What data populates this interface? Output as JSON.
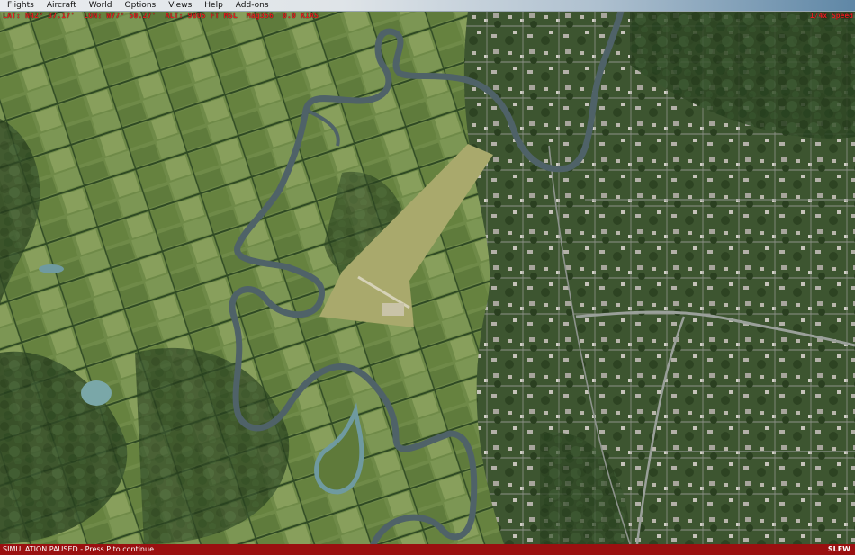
{
  "menu": {
    "items": [
      "Flights",
      "Aircraft",
      "World",
      "Options",
      "Views",
      "Help",
      "Add-ons"
    ]
  },
  "hud": {
    "readout": "LAT: N42° 37.17'  LON: W77° 50.27'  ALT: 9805 FT MSL  Mag356  0.0 KIAS",
    "right": "1/4x Speed"
  },
  "status": {
    "left": "SIMULATION PAUSED - Press P to continue.",
    "right": "SLEW"
  },
  "colors": {
    "hud_text": "#e22020",
    "status_bg": "#9a1010",
    "river": "#4f6268",
    "farmland": "#6f8a48",
    "forest": "#2c4422"
  }
}
